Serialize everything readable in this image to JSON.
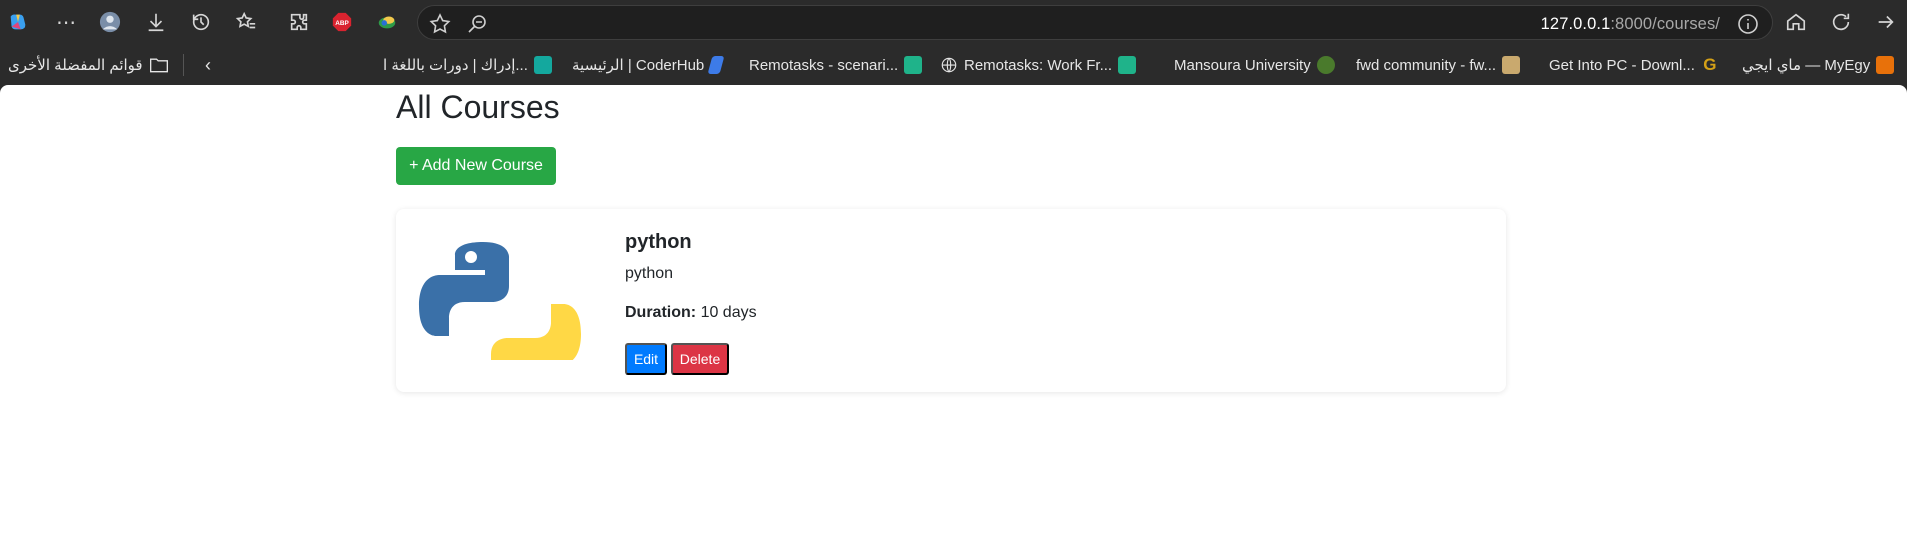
{
  "browser": {
    "address_url_host": "127.0.0.1",
    "address_url_rest": ":8000/courses/",
    "toolbar_icons": [
      "copilot-icon",
      "more-icon",
      "profile-avatar",
      "download-icon",
      "history-icon",
      "favorites-icon",
      "extensions-icon",
      "adblock-icon",
      "extension-icon",
      "star-icon",
      "zoom-icon",
      "info-icon",
      "home-icon",
      "refresh-icon",
      "forward-icon"
    ],
    "adblock_label": "ABP"
  },
  "bookmarks": {
    "other_favorites": "قوائم المفضلة الأخرى",
    "items": [
      {
        "label": "ماي ايجي — MyEgy",
        "color": "#e8710a"
      },
      {
        "label": "Get Into PC - Downl...",
        "color": "#d4a017"
      },
      {
        "label": "fwd community - fw...",
        "color": "#c9a96e"
      },
      {
        "label": "Mansoura University",
        "color": "#4a7a2c"
      },
      {
        "label": "Remotasks: Work Fr...",
        "color": "#1fb38a"
      },
      {
        "label": "Remotasks - scenari...",
        "color": "#1fb38a"
      },
      {
        "label": "الرئيسية | CoderHub",
        "color": "#3d7be8"
      },
      {
        "label": "إدراك | دورات باللغة ا...",
        "color": "#14a89e"
      }
    ]
  },
  "main": {
    "page_title": "All Courses",
    "add_button": "+ Add New Course",
    "courses": [
      {
        "name": "python",
        "description": "python",
        "duration_label": "Duration:",
        "duration_value": "10 days",
        "edit_label": "Edit",
        "delete_label": "Delete"
      }
    ]
  },
  "colors": {
    "success": "#28a745",
    "primary": "#007bff",
    "danger": "#dc3545"
  }
}
